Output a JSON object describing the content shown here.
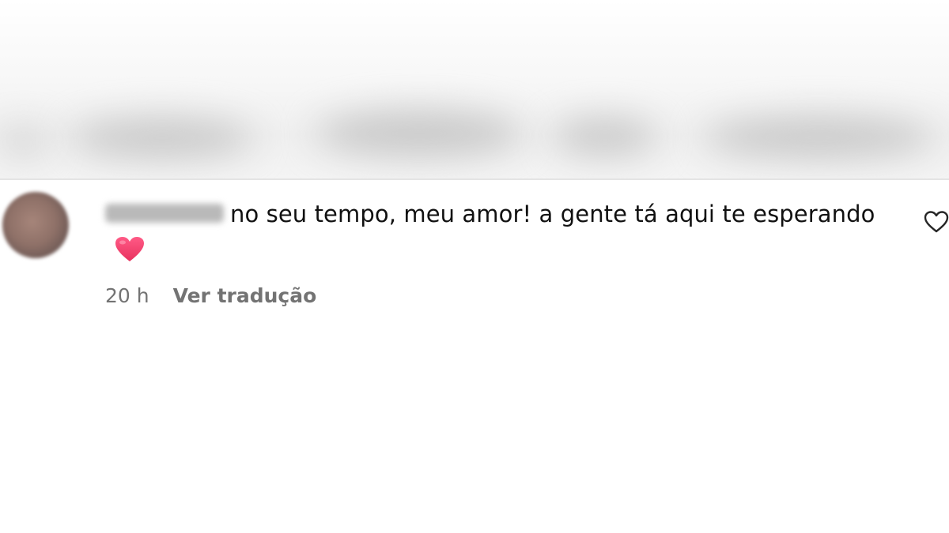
{
  "comment": {
    "text": "no seu tempo, meu amor! a gente tá aqui te esperando",
    "emoji": "heart-emoji",
    "timestamp": "20 h",
    "translate_label": "Ver tradução"
  },
  "icons": {
    "like": "heart-outline-icon"
  },
  "colors": {
    "text_primary": "#111111",
    "text_secondary": "#737373",
    "heart_emoji": "#f23e6b"
  }
}
